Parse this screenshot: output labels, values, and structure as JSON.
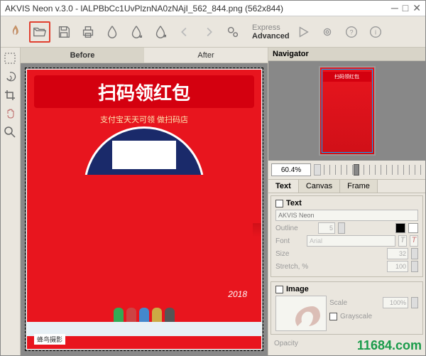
{
  "title": "AKVIS Neon v.3.0 - lALPBbCc1UvPlznNA0zNAjI_562_844.png  (562x844)",
  "modes": {
    "express": "Express",
    "advanced": "Advanced"
  },
  "viewTabs": {
    "before": "Before",
    "after": "After"
  },
  "navigator": {
    "title": "Navigator",
    "zoom": "60.4%"
  },
  "propTabs": {
    "text": "Text",
    "canvas": "Canvas",
    "frame": "Frame"
  },
  "textSection": {
    "header": "Text",
    "textPlaceholder": "AKVIS Neon",
    "outlineLabel": "Outline",
    "outlineValue": "5",
    "fontLabel": "Font",
    "fontValue": "Arial",
    "sizeLabel": "Size",
    "sizeValue": "32",
    "stretchLabel": "Stretch, %",
    "stretchValue": "100"
  },
  "imageSection": {
    "header": "Image",
    "scaleLabel": "Scale",
    "scaleValue": "100%",
    "grayLabel": "Grayscale"
  },
  "opacityLabel": "Opacity",
  "preview": {
    "banner": "扫码领红包",
    "subtext": "支付宝天天可领 做扫码店",
    "year": "2018",
    "footTag": "蜂鸟摄影"
  },
  "watermark": "11684.com"
}
